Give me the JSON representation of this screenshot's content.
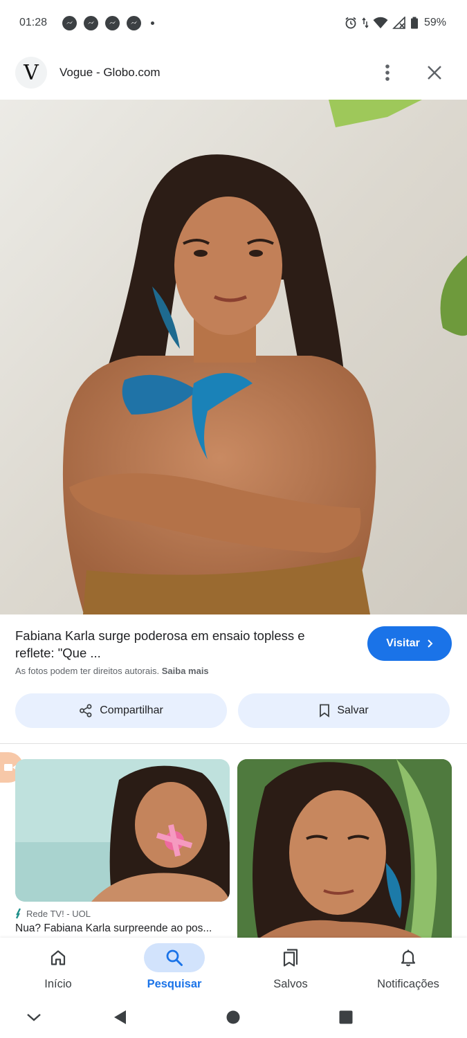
{
  "status_bar": {
    "time": "01:28",
    "battery": "59%",
    "notification_icons": [
      "messenger-icon",
      "messenger-icon",
      "messenger-icon",
      "messenger-icon"
    ]
  },
  "header": {
    "logo_letter": "V",
    "site_name": "Vogue - Globo.com"
  },
  "result": {
    "title": "Fabiana Karla surge poderosa em ensaio topless e reflete: \"Que ...",
    "copyright_text": "As fotos podem ter direitos autorais.",
    "learn_more": "Saiba mais",
    "visit_label": "Visitar"
  },
  "actions": {
    "share_label": "Compartilhar",
    "save_label": "Salvar"
  },
  "related": {
    "source": "Rede TV! - UOL",
    "title": "Nua? Fabiana Karla surpreende ao pos..."
  },
  "bottom_nav": {
    "items": [
      {
        "label": "Início",
        "icon": "home-icon"
      },
      {
        "label": "Pesquisar",
        "icon": "search-icon"
      },
      {
        "label": "Salvos",
        "icon": "bookmarks-icon"
      },
      {
        "label": "Notificações",
        "icon": "bell-icon"
      }
    ],
    "active": "Pesquisar"
  },
  "colors": {
    "accent": "#1a73e8",
    "pill_bg": "#e8f0fe",
    "active_nav_bg": "#d2e3fc"
  }
}
